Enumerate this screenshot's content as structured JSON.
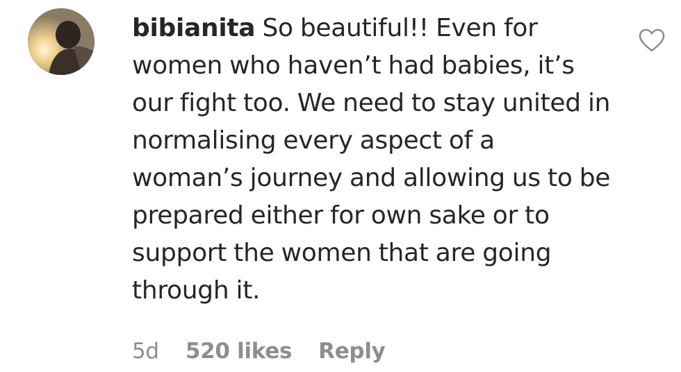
{
  "comment": {
    "username": "bibianita",
    "text": "So beautiful!! Even for women who haven’t had babies, it’s our fight too. We need to stay united in normalising every aspect of a woman’s journey and allowing us to be prepared either for own sake or to support the women that are going through it.",
    "timestamp": "5d",
    "likes": "520 likes",
    "reply_label": "Reply",
    "like_icon": "heart-outline-icon",
    "like_icon_color": "#8e8e8e"
  },
  "colors": {
    "text": "#262626",
    "secondary_text": "#8e8e8e",
    "background": "#ffffff"
  }
}
